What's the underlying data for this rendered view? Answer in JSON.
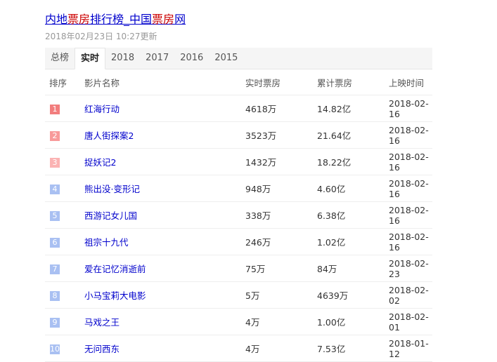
{
  "header": {
    "title_parts": [
      "内地",
      "票房",
      "排行榜_中国",
      "票房",
      "网"
    ],
    "updated": "2018年02月23日 10:27更新"
  },
  "tabs": [
    {
      "label": "总榜"
    },
    {
      "label": "实时",
      "active": true
    },
    {
      "label": "2018"
    },
    {
      "label": "2017"
    },
    {
      "label": "2016"
    },
    {
      "label": "2015"
    }
  ],
  "columns": [
    "排序",
    "影片名称",
    "实时票房",
    "累计票房",
    "上映时间"
  ],
  "rank_colors": {
    "1": "#f27d7d",
    "2": "#f89a9a",
    "3": "#fbb3b3",
    "other": "#a9c0f2"
  },
  "rows": [
    {
      "rank": "1",
      "name": "红海行动",
      "realtime": "4618万",
      "total": "14.82亿",
      "date": "2018-02-16"
    },
    {
      "rank": "2",
      "name": "唐人街探案2",
      "realtime": "3523万",
      "total": "21.64亿",
      "date": "2018-02-16"
    },
    {
      "rank": "3",
      "name": "捉妖记2",
      "realtime": "1432万",
      "total": "18.22亿",
      "date": "2018-02-16"
    },
    {
      "rank": "4",
      "name": "熊出没·变形记",
      "realtime": "948万",
      "total": "4.60亿",
      "date": "2018-02-16"
    },
    {
      "rank": "5",
      "name": "西游记女儿国",
      "realtime": "338万",
      "total": "6.38亿",
      "date": "2018-02-16"
    },
    {
      "rank": "6",
      "name": "祖宗十九代",
      "realtime": "246万",
      "total": "1.02亿",
      "date": "2018-02-16"
    },
    {
      "rank": "7",
      "name": "爱在记忆消逝前",
      "realtime": "75万",
      "total": "84万",
      "date": "2018-02-23"
    },
    {
      "rank": "8",
      "name": "小马宝莉大电影",
      "realtime": "5万",
      "total": "4639万",
      "date": "2018-02-02"
    },
    {
      "rank": "9",
      "name": "马戏之王",
      "realtime": "4万",
      "total": "1.00亿",
      "date": "2018-02-01"
    },
    {
      "rank": "10",
      "name": "无问西东",
      "realtime": "4万",
      "total": "7.53亿",
      "date": "2018-01-12"
    }
  ]
}
